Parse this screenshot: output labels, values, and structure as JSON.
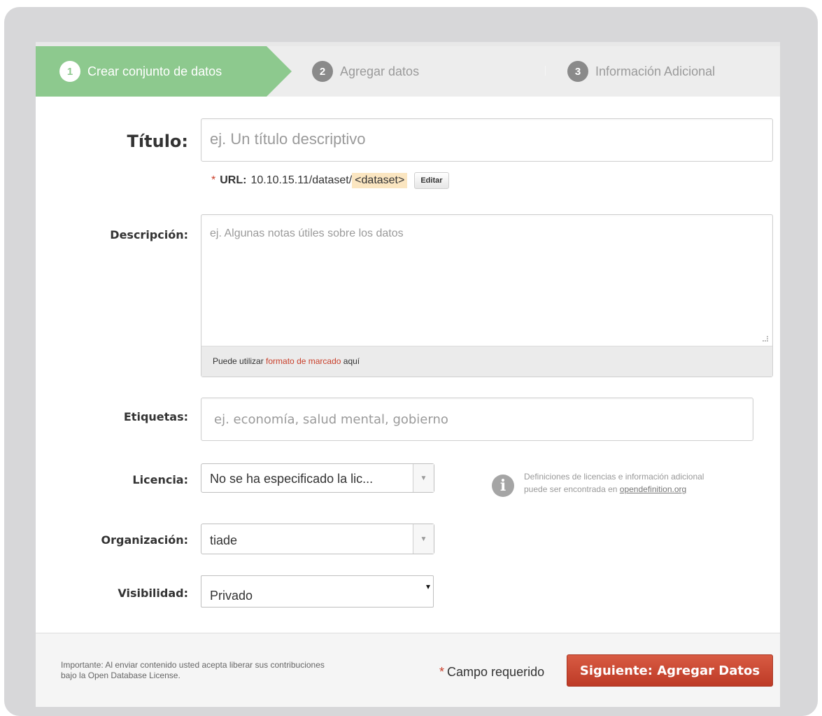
{
  "stages": [
    {
      "number": "1",
      "label": "Crear conjunto de datos"
    },
    {
      "number": "2",
      "label": "Agregar datos"
    },
    {
      "number": "3",
      "label": "Información Adicional"
    }
  ],
  "title_field": {
    "label": "Título:",
    "placeholder": "ej. Un título descriptivo"
  },
  "url": {
    "required_mark": "*",
    "label": "URL:",
    "prefix": "10.10.15.11/dataset/",
    "slug": "<dataset>",
    "edit_label": "Editar"
  },
  "description_field": {
    "label": "Descripción:",
    "placeholder": "ej. Algunas notas útiles sobre los datos",
    "markdown_prefix": "Puede utilizar ",
    "markdown_link": "formato de marcado",
    "markdown_suffix": " aquí"
  },
  "tags_field": {
    "label": "Etiquetas:",
    "placeholder": "ej. economía, salud mental, gobierno"
  },
  "license_field": {
    "label": "Licencia:",
    "value": "No se ha especificado la lic..."
  },
  "license_info": {
    "icon": "info-icon",
    "line1": "Definiciones de licencias e información adicional",
    "line2_prefix": "puede ser encontrada en ",
    "line2_link": "opendefinition.org"
  },
  "organization_field": {
    "label": "Organización:",
    "value": "tiade"
  },
  "visibility_field": {
    "label": "Visibilidad:",
    "value": "Privado"
  },
  "footer": {
    "legal_line1": "Importante: Al enviar contenido usted acepta liberar sus contribuciones",
    "legal_line2": "bajo la Open Database License.",
    "required_mark": "*",
    "required_note": "Campo requerido",
    "submit_label": "Siguiente: Agregar Datos"
  },
  "colors": {
    "active_stage": "#8dc98e",
    "accent_red": "#c9402b"
  }
}
